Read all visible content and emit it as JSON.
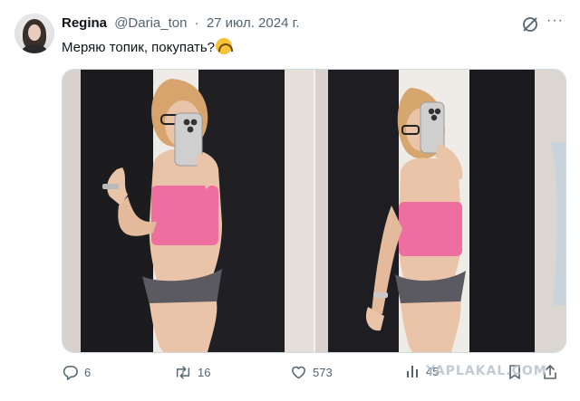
{
  "author": {
    "display_name": "Regina",
    "handle": "@Daria_ton",
    "separator": "·",
    "date": "27 июл. 2024 г."
  },
  "tweet": {
    "text": "Меряю топик, покупать?",
    "emoji": "upside-down-face-emoji"
  },
  "icons": {
    "grok": "grok-icon",
    "more": "more-icon",
    "more_glyph": "···"
  },
  "media": {
    "photos": [
      {
        "name": "photo-mirror-selfie-left"
      },
      {
        "name": "photo-mirror-selfie-right"
      }
    ]
  },
  "actions": {
    "replies": "6",
    "retweets": "16",
    "likes": "573",
    "views": "45"
  },
  "watermark": "YAPLAKAL.COM",
  "colors": {
    "text_primary": "#0f1419",
    "text_secondary": "#536471",
    "top_pink": "#ee6f9f"
  }
}
